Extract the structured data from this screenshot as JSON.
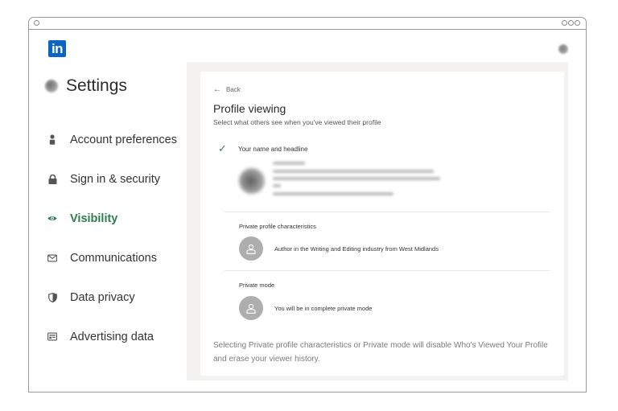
{
  "app": {
    "brand": "in",
    "brand_color": "#0a66c2",
    "accent_color": "#2e7d4f"
  },
  "sidebar": {
    "title": "Settings",
    "items": [
      {
        "label": "Account preferences",
        "icon": "person-icon",
        "active": false
      },
      {
        "label": "Sign in & security",
        "icon": "lock-icon",
        "active": false
      },
      {
        "label": "Visibility",
        "icon": "eye-icon",
        "active": true
      },
      {
        "label": "Communications",
        "icon": "envelope-icon",
        "active": false
      },
      {
        "label": "Data privacy",
        "icon": "shield-icon",
        "active": false
      },
      {
        "label": "Advertising data",
        "icon": "ad-card-icon",
        "active": false
      }
    ]
  },
  "main": {
    "back_label": "Back",
    "title": "Profile viewing",
    "subtitle": "Select what others see when you've viewed their profile",
    "options": [
      {
        "label": "Your name and headline",
        "selected": true
      },
      {
        "label": "Private profile characteristics",
        "description": "Author in the Writing and Editing industry from West Midlands",
        "selected": false
      },
      {
        "label": "Private mode",
        "description": "You will be in complete private mode",
        "selected": false
      }
    ],
    "footnote": "Selecting Private profile characteristics or Private mode will disable Who's Viewed Your Profile and erase your viewer history."
  }
}
